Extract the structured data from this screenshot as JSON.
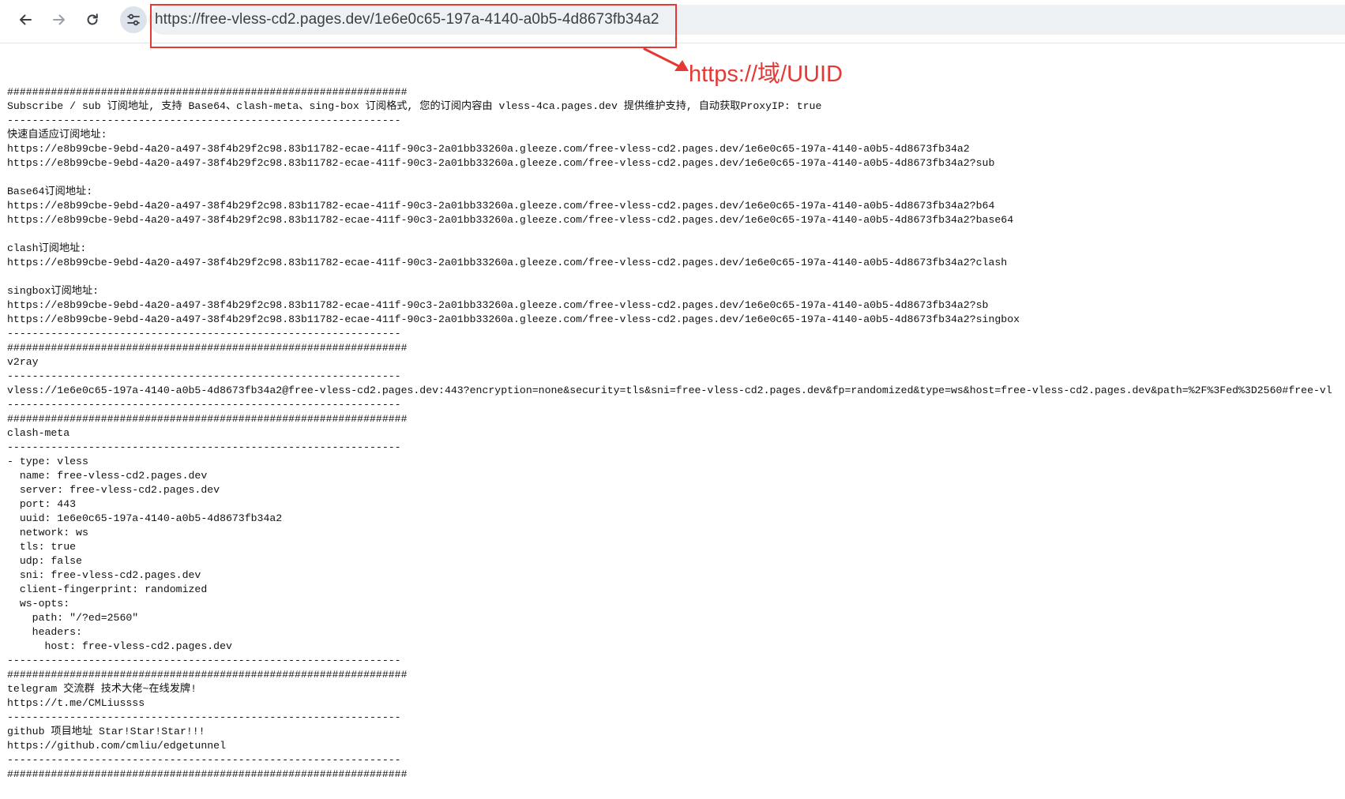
{
  "browser": {
    "url": "https://free-vless-cd2.pages.dev/1e6e0c65-197a-4140-a0b5-4d8673fb34a2",
    "back_icon": "arrow-left-icon",
    "forward_icon": "arrow-right-icon",
    "reload_icon": "reload-icon",
    "site_info_icon": "tune-icon"
  },
  "annotation": {
    "label": "https://域/UUID",
    "color": "#e53935"
  },
  "page": {
    "lines": [
      "",
      "################################################################",
      "Subscribe / sub 订阅地址, 支持 Base64、clash-meta、sing-box 订阅格式, 您的订阅内容由 vless-4ca.pages.dev 提供维护支持, 自动获取ProxyIP: true",
      "---------------------------------------------------------------",
      "快速自适应订阅地址:",
      "https://e8b99cbe-9ebd-4a20-a497-38f4b29f2c98.83b11782-ecae-411f-90c3-2a01bb33260a.gleeze.com/free-vless-cd2.pages.dev/1e6e0c65-197a-4140-a0b5-4d8673fb34a2",
      "https://e8b99cbe-9ebd-4a20-a497-38f4b29f2c98.83b11782-ecae-411f-90c3-2a01bb33260a.gleeze.com/free-vless-cd2.pages.dev/1e6e0c65-197a-4140-a0b5-4d8673fb34a2?sub",
      "",
      "Base64订阅地址:",
      "https://e8b99cbe-9ebd-4a20-a497-38f4b29f2c98.83b11782-ecae-411f-90c3-2a01bb33260a.gleeze.com/free-vless-cd2.pages.dev/1e6e0c65-197a-4140-a0b5-4d8673fb34a2?b64",
      "https://e8b99cbe-9ebd-4a20-a497-38f4b29f2c98.83b11782-ecae-411f-90c3-2a01bb33260a.gleeze.com/free-vless-cd2.pages.dev/1e6e0c65-197a-4140-a0b5-4d8673fb34a2?base64",
      "",
      "clash订阅地址:",
      "https://e8b99cbe-9ebd-4a20-a497-38f4b29f2c98.83b11782-ecae-411f-90c3-2a01bb33260a.gleeze.com/free-vless-cd2.pages.dev/1e6e0c65-197a-4140-a0b5-4d8673fb34a2?clash",
      "",
      "singbox订阅地址:",
      "https://e8b99cbe-9ebd-4a20-a497-38f4b29f2c98.83b11782-ecae-411f-90c3-2a01bb33260a.gleeze.com/free-vless-cd2.pages.dev/1e6e0c65-197a-4140-a0b5-4d8673fb34a2?sb",
      "https://e8b99cbe-9ebd-4a20-a497-38f4b29f2c98.83b11782-ecae-411f-90c3-2a01bb33260a.gleeze.com/free-vless-cd2.pages.dev/1e6e0c65-197a-4140-a0b5-4d8673fb34a2?singbox",
      "---------------------------------------------------------------",
      "################################################################",
      "v2ray",
      "---------------------------------------------------------------",
      "vless://1e6e0c65-197a-4140-a0b5-4d8673fb34a2@free-vless-cd2.pages.dev:443?encryption=none&security=tls&sni=free-vless-cd2.pages.dev&fp=randomized&type=ws&host=free-vless-cd2.pages.dev&path=%2F%3Fed%3D2560#free-vl",
      "---------------------------------------------------------------",
      "################################################################",
      "clash-meta",
      "---------------------------------------------------------------",
      "- type: vless",
      "  name: free-vless-cd2.pages.dev",
      "  server: free-vless-cd2.pages.dev",
      "  port: 443",
      "  uuid: 1e6e0c65-197a-4140-a0b5-4d8673fb34a2",
      "  network: ws",
      "  tls: true",
      "  udp: false",
      "  sni: free-vless-cd2.pages.dev",
      "  client-fingerprint: randomized",
      "  ws-opts:",
      "    path: \"/?ed=2560\"",
      "    headers:",
      "      host: free-vless-cd2.pages.dev",
      "---------------------------------------------------------------",
      "################################################################",
      "telegram 交流群 技术大佬~在线发牌!",
      "https://t.me/CMLiussss",
      "---------------------------------------------------------------",
      "github 项目地址 Star!Star!Star!!!",
      "https://github.com/cmliu/edgetunnel",
      "---------------------------------------------------------------",
      "################################################################"
    ]
  }
}
